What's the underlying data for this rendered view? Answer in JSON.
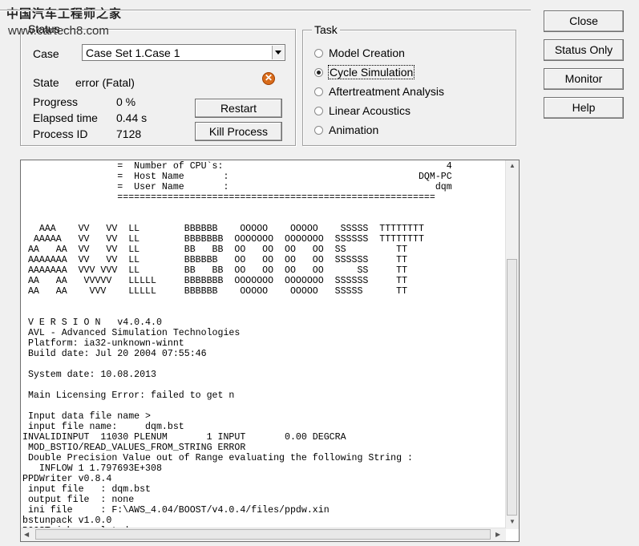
{
  "watermark": {
    "line1": "中国汽车工程师之家",
    "line2": "www.cartech8.com"
  },
  "status": {
    "legend": "Status",
    "case_label": "Case",
    "case_value": "Case Set 1.Case 1",
    "state_label": "State",
    "state_value": "error (Fatal)",
    "progress_label": "Progress",
    "progress_value": "0 %",
    "elapsed_label": "Elapsed time",
    "elapsed_value": "0.44 s",
    "pid_label": "Process ID",
    "pid_value": "7128",
    "restart_label": "Restart",
    "kill_label": "Kill Process"
  },
  "task": {
    "legend": "Task",
    "options": [
      {
        "label": "Model Creation",
        "selected": false
      },
      {
        "label": "Cycle Simulation",
        "selected": true
      },
      {
        "label": "Aftertreatment Analysis",
        "selected": false
      },
      {
        "label": "Linear Acoustics",
        "selected": false
      },
      {
        "label": "Animation",
        "selected": false
      }
    ]
  },
  "side_buttons": {
    "close": "Close",
    "status_only": "Status Only",
    "monitor": "Monitor",
    "help": "Help"
  },
  "console": {
    "text": "                 =  Number of CPU`s:                                        4\n                 =  Host Name       :                                  DQM-PC\n                 =  User Name       :                                     dqm\n                 =========================================================\n\n\n   AAA    VV   VV  LL        BBBBBB    OOOOO    OOOOO    SSSSS  TTTTTTTT\n  AAAAA   VV   VV  LL        BBBBBBB  OOOOOOO  OOOOOOO  SSSSSS  TTTTTTTT\n AA   AA  VV   VV  LL        BB   BB  OO   OO  OO   OO  SS         TT\n AAAAAAA  VV   VV  LL        BBBBBB   OO   OO  OO   OO  SSSSSS     TT\n AAAAAAA  VVV VVV  LL        BB   BB  OO   OO  OO   OO      SS     TT\n AA   AA   VVVVV   LLLLL     BBBBBBB  OOOOOOO  OOOOOOO  SSSSSS     TT\n AA   AA    VVV    LLLLL     BBBBBB    OOOOO    OOOOO   SSSSS      TT\n\n\n V E R S I O N   v4.0.4.0\n AVL - Advanced Simulation Technologies\n Platform: ia32-unknown-winnt\n Build date: Jul 20 2004 07:55:46\n\n System date: 10.08.2013\n\n Main Licensing Error: failed to get n\n\n Input data file name >\n input file name:     dqm.bst\nINVALIDINPUT  11030 PLENUM       1 INPUT       0.00 DEGCRA\n MOD_BSTIO/READ_VALUES_FROM_STRING ERROR\n Double Precision Value out of Range evaluating the following String :\n   INFLOW 1 1.797693E+308\nPPDWriter v0.8.4\n input file   : dqm.bst\n output file  : none\n ini file     : F:\\AWS_4.04/BOOST/v4.0.4/files/ppdw.xin\nbstunpack v1.0.0\nBOOST job completed."
  },
  "icons": {
    "error": "error-icon"
  }
}
